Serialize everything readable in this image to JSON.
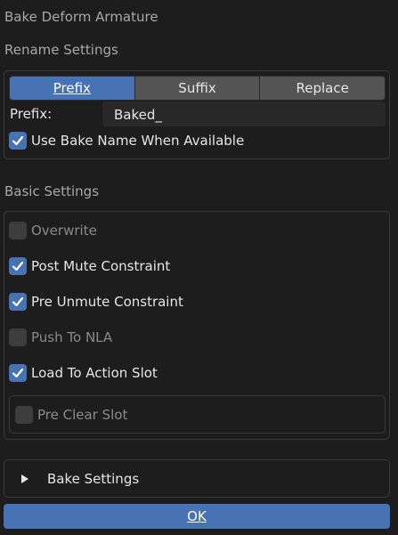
{
  "dialog": {
    "title": "Bake Deform Armature"
  },
  "rename": {
    "section_label": "Rename Settings",
    "tabs": [
      {
        "label": "Prefix",
        "active": true
      },
      {
        "label": "Suffix",
        "active": false
      },
      {
        "label": "Replace",
        "active": false
      }
    ],
    "field_label": "Prefix:",
    "field_value": "Baked_",
    "use_bake_name": {
      "label": "Use Bake Name When Available",
      "checked": true
    }
  },
  "basic": {
    "section_label": "Basic Settings",
    "options": [
      {
        "label": "Overwrite",
        "checked": false,
        "enabled": false
      },
      {
        "label": "Post Mute Constraint",
        "checked": true,
        "enabled": true
      },
      {
        "label": "Pre Unmute Constraint",
        "checked": true,
        "enabled": true
      },
      {
        "label": "Push To NLA",
        "checked": false,
        "enabled": false
      },
      {
        "label": "Load To Action Slot",
        "checked": true,
        "enabled": true
      },
      {
        "label": "Pre Clear Slot",
        "checked": false,
        "enabled": false
      }
    ]
  },
  "bake_settings": {
    "label": "Bake Settings",
    "expanded": false
  },
  "ok_button": {
    "label": "OK"
  },
  "colors": {
    "accent": "#4772b3",
    "background": "#1d1d1d",
    "widget": "#545454"
  },
  "icons": {
    "check": "checkmark-icon",
    "disclosure": "triangle-right-icon"
  }
}
